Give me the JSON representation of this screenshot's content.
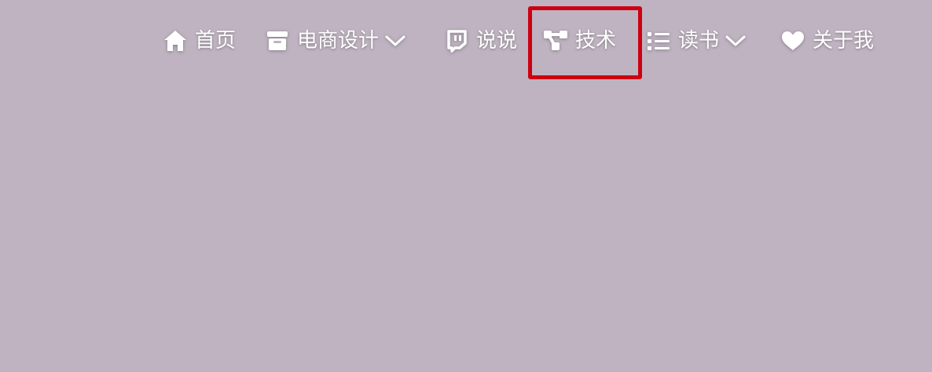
{
  "nav": {
    "items": [
      {
        "label": "首页",
        "icon": "home-icon"
      },
      {
        "label": "电商设计",
        "icon": "archive-icon",
        "dropdown": true
      },
      {
        "label": "说说",
        "icon": "chat-bubble-icon"
      },
      {
        "label": "技术",
        "icon": "share-nodes-icon"
      },
      {
        "label": "读书",
        "icon": "list-icon",
        "dropdown": true
      },
      {
        "label": "关于我",
        "icon": "heart-icon"
      }
    ]
  },
  "colors": {
    "background": "#bfb3c1",
    "text": "#ffffff",
    "highlight_box": "#cc0011"
  }
}
